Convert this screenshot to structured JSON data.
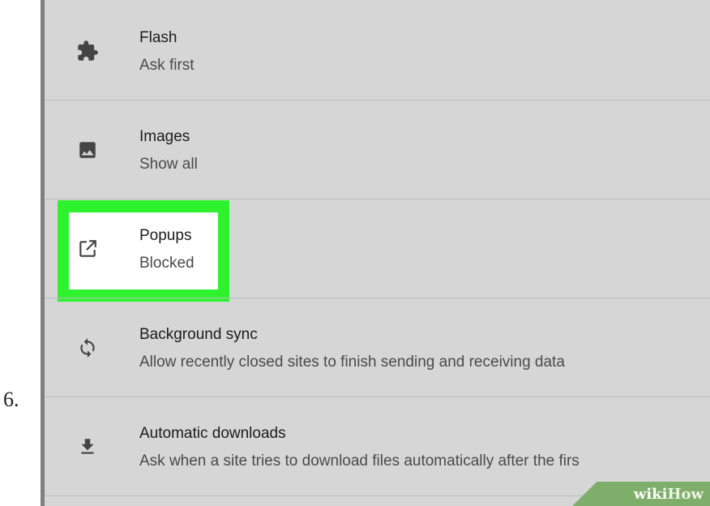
{
  "step": {
    "number": "6."
  },
  "settings": {
    "items": [
      {
        "title": "Flash",
        "subtitle": "Ask first",
        "icon": "puzzle-icon"
      },
      {
        "title": "Images",
        "subtitle": "Show all",
        "icon": "image-icon"
      },
      {
        "title": "Popups",
        "subtitle": "Blocked",
        "icon": "open-in-new-icon",
        "highlighted": true
      },
      {
        "title": "Background sync",
        "subtitle": "Allow recently closed sites to finish sending and receiving data",
        "icon": "sync-icon"
      },
      {
        "title": "Automatic downloads",
        "subtitle": "Ask when a site tries to download files automatically after the firs",
        "icon": "download-icon"
      }
    ]
  },
  "watermark": {
    "part1": "wiki",
    "part2": "How"
  },
  "colors": {
    "highlight": "#2ef22e",
    "panel": "#d6d6d6",
    "watermark": "#7fae6a"
  }
}
